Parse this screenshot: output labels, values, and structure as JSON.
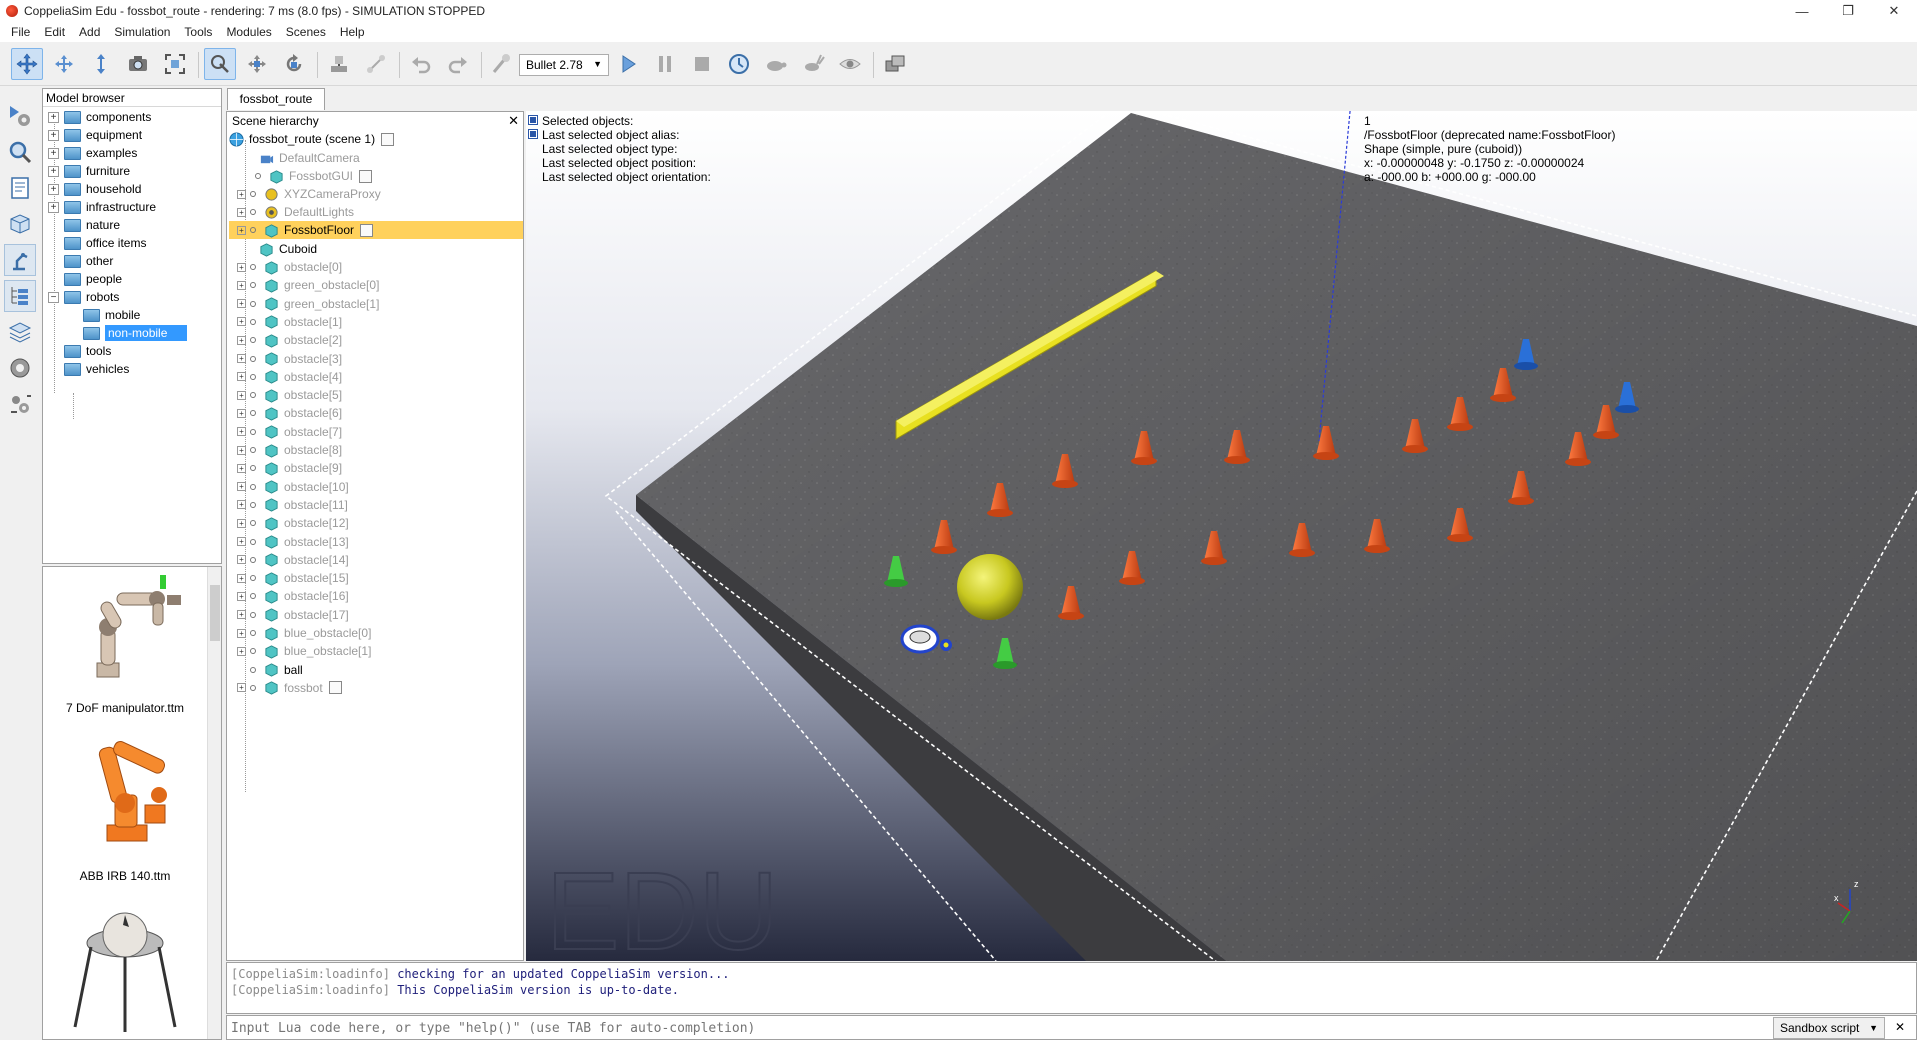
{
  "window": {
    "title": "CoppeliaSim Edu - fossbot_route - rendering: 7 ms (8.0 fps) - SIMULATION STOPPED",
    "minimize": "—",
    "maximize": "❐",
    "close": "✕"
  },
  "menu": [
    "File",
    "Edit",
    "Add",
    "Simulation",
    "Tools",
    "Modules",
    "Scenes",
    "Help"
  ],
  "toolbar": {
    "physics_engine": "Bullet 2.78"
  },
  "model_browser": {
    "title": "Model browser",
    "items": [
      {
        "label": "components",
        "expandable": "+"
      },
      {
        "label": "equipment",
        "expandable": "+"
      },
      {
        "label": "examples",
        "expandable": "+"
      },
      {
        "label": "furniture",
        "expandable": "+"
      },
      {
        "label": "household",
        "expandable": "+"
      },
      {
        "label": "infrastructure",
        "expandable": "+"
      },
      {
        "label": "nature",
        "expandable": ""
      },
      {
        "label": "office items",
        "expandable": ""
      },
      {
        "label": "other",
        "expandable": ""
      },
      {
        "label": "people",
        "expandable": ""
      },
      {
        "label": "robots",
        "expandable": "−"
      },
      {
        "label": "mobile",
        "expandable": ""
      },
      {
        "label": "non-mobile",
        "expandable": ""
      },
      {
        "label": "tools",
        "expandable": ""
      },
      {
        "label": "vehicles",
        "expandable": ""
      }
    ],
    "thumbnails": [
      {
        "caption": "7 DoF manipulator.ttm"
      },
      {
        "caption": "ABB IRB 140.ttm"
      },
      {
        "caption": ""
      }
    ]
  },
  "scene_tab": "fossbot_route",
  "hierarchy": {
    "title": "Scene hierarchy",
    "close": "✕",
    "root": "fossbot_route (scene 1)",
    "items": [
      {
        "label": "DefaultCamera"
      },
      {
        "label": "FossbotGUI"
      },
      {
        "label": "XYZCameraProxy"
      },
      {
        "label": "DefaultLights"
      },
      {
        "label": "FossbotFloor"
      },
      {
        "label": "Cuboid"
      },
      {
        "label": "obstacle[0]"
      },
      {
        "label": "green_obstacle[0]"
      },
      {
        "label": "green_obstacle[1]"
      },
      {
        "label": "obstacle[1]"
      },
      {
        "label": "obstacle[2]"
      },
      {
        "label": "obstacle[3]"
      },
      {
        "label": "obstacle[4]"
      },
      {
        "label": "obstacle[5]"
      },
      {
        "label": "obstacle[6]"
      },
      {
        "label": "obstacle[7]"
      },
      {
        "label": "obstacle[8]"
      },
      {
        "label": "obstacle[9]"
      },
      {
        "label": "obstacle[10]"
      },
      {
        "label": "obstacle[11]"
      },
      {
        "label": "obstacle[12]"
      },
      {
        "label": "obstacle[13]"
      },
      {
        "label": "obstacle[14]"
      },
      {
        "label": "obstacle[15]"
      },
      {
        "label": "obstacle[16]"
      },
      {
        "label": "obstacle[17]"
      },
      {
        "label": "blue_obstacle[0]"
      },
      {
        "label": "blue_obstacle[1]"
      },
      {
        "label": "ball"
      },
      {
        "label": "fossbot"
      }
    ]
  },
  "viewport": {
    "info": [
      {
        "label": "Selected objects:",
        "value": "1"
      },
      {
        "label": "Last selected object alias:",
        "value": "/FossbotFloor   (deprecated name:FossbotFloor)"
      },
      {
        "label": "Last selected object type:",
        "value": "Shape (simple, pure (cuboid))"
      },
      {
        "label": "Last selected object position:",
        "value": "x: -0.00000048   y: -0.1750   z: -0.00000024"
      },
      {
        "label": "Last selected object orientation:",
        "value": "a: -000.00   b: +000.00   g: -000.00"
      }
    ],
    "watermark": "EDU",
    "axis_x": "x",
    "axis_z": "z",
    "colors": {
      "cone_orange": "#e0521c",
      "cone_green": "#3bc23b",
      "cone_blue": "#2266cc",
      "bar_yellow": "#e8e020",
      "ball_yellow": "#c8c820",
      "floor": "#6e6e70"
    }
  },
  "console": {
    "lines": [
      {
        "tag": "[CoppeliaSim:loadinfo]",
        "msg": "checking for an updated CoppeliaSim version..."
      },
      {
        "tag": "[CoppeliaSim:loadinfo]",
        "msg": "This CoppeliaSim version is up-to-date."
      }
    ]
  },
  "lua": {
    "placeholder": "Input Lua code here, or type \"help()\" (use TAB for auto-completion)",
    "script_selector": "Sandbox script",
    "close": "✕"
  }
}
